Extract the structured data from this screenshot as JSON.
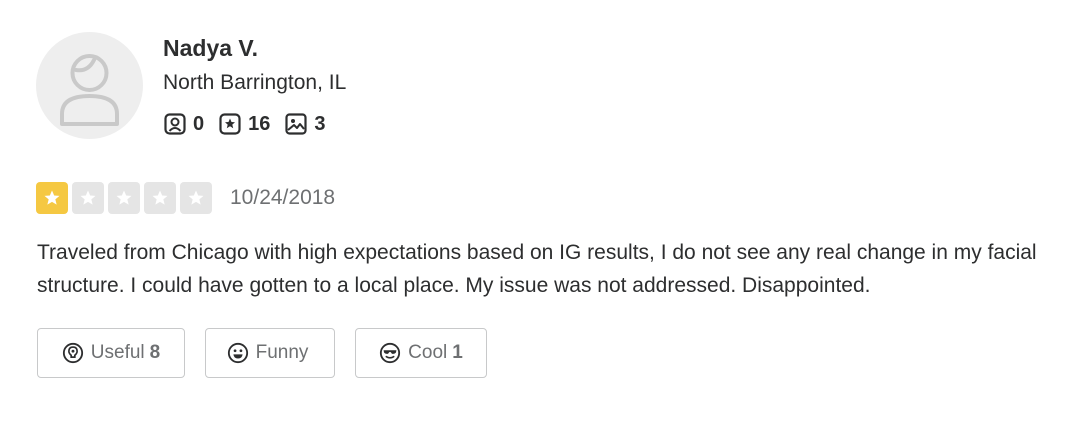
{
  "user": {
    "name": "Nadya V.",
    "location": "North Barrington, IL",
    "stats": [
      {
        "icon": "friends-icon",
        "value": "0"
      },
      {
        "icon": "review-star-icon",
        "value": "16"
      },
      {
        "icon": "photo-icon",
        "value": "3"
      }
    ]
  },
  "review": {
    "rating": 1,
    "max_rating": 5,
    "date": "10/24/2018",
    "text": "Traveled from Chicago with high expectations based on IG results, I do not see any real change in my facial structure. I could have gotten to a local place. My issue was not addressed. Disappointed."
  },
  "reactions": {
    "useful": {
      "label": "Useful",
      "count": "8"
    },
    "funny": {
      "label": "Funny",
      "count": ""
    },
    "cool": {
      "label": "Cool",
      "count": "1"
    }
  },
  "colors": {
    "star_filled": "#f5c842",
    "star_empty": "#e5e5e5",
    "text": "#2d2e2f",
    "muted": "#6e7072"
  }
}
